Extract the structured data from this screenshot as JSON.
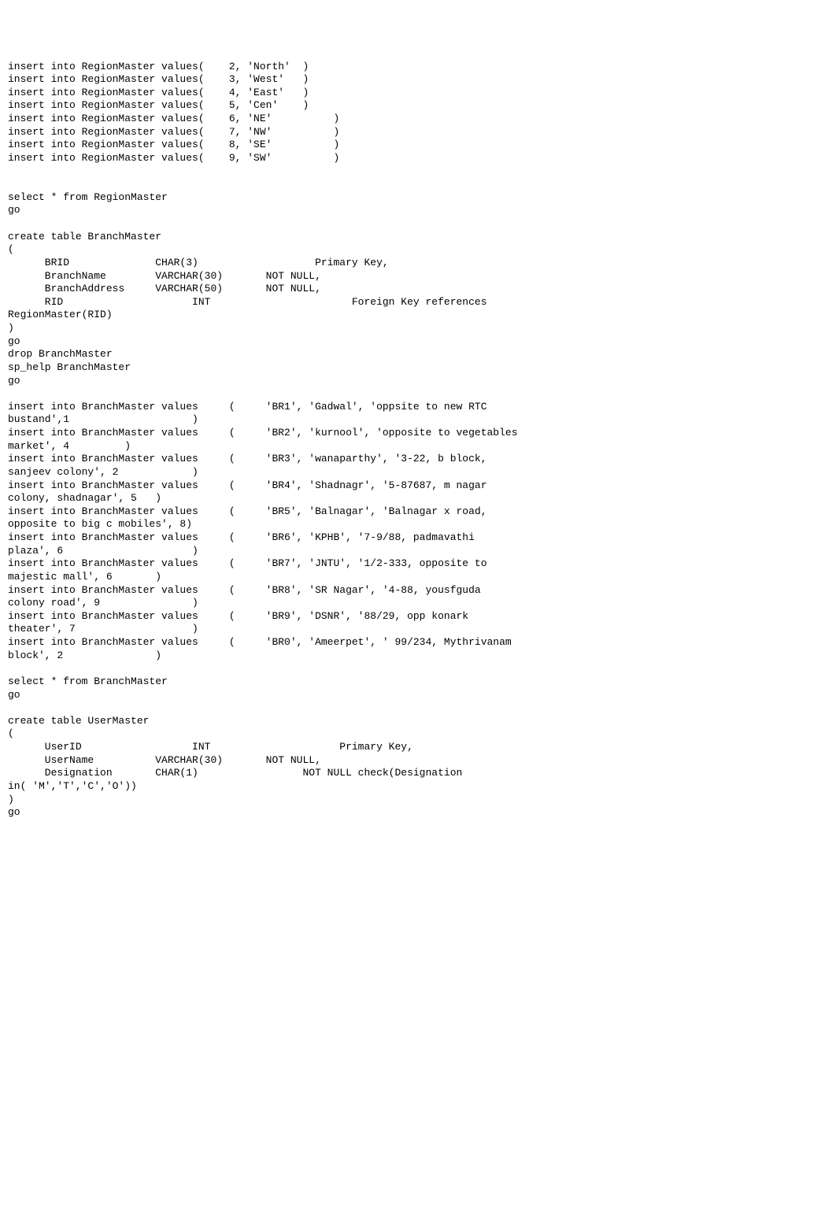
{
  "lines": [
    "insert into RegionMaster values(    2, 'North'  )",
    "insert into RegionMaster values(    3, 'West'   )",
    "insert into RegionMaster values(    4, 'East'   )",
    "insert into RegionMaster values(    5, 'Cen'    )",
    "insert into RegionMaster values(    6, 'NE'          )",
    "insert into RegionMaster values(    7, 'NW'          )",
    "insert into RegionMaster values(    8, 'SE'          )",
    "insert into RegionMaster values(    9, 'SW'          )",
    "",
    "",
    "select * from RegionMaster",
    "go",
    "",
    "create table BranchMaster",
    "(",
    "      BRID              CHAR(3)                   Primary Key,",
    "      BranchName        VARCHAR(30)       NOT NULL,",
    "      BranchAddress     VARCHAR(50)       NOT NULL,",
    "      RID                     INT                       Foreign Key references",
    "RegionMaster(RID)",
    ")",
    "go",
    "drop BranchMaster",
    "sp_help BranchMaster",
    "go",
    "",
    "insert into BranchMaster values     (     'BR1', 'Gadwal', 'oppsite to new RTC",
    "bustand',1                    )",
    "insert into BranchMaster values     (     'BR2', 'kurnool', 'opposite to vegetables",
    "market', 4         )",
    "insert into BranchMaster values     (     'BR3', 'wanaparthy', '3-22, b block,",
    "sanjeev colony', 2            )",
    "insert into BranchMaster values     (     'BR4', 'Shadnagr', '5-87687, m nagar",
    "colony, shadnagar', 5   )",
    "insert into BranchMaster values     (     'BR5', 'Balnagar', 'Balnagar x road,",
    "opposite to big c mobiles', 8)",
    "insert into BranchMaster values     (     'BR6', 'KPHB', '7-9/88, padmavathi",
    "plaza', 6                     )",
    "insert into BranchMaster values     (     'BR7', 'JNTU', '1/2-333, opposite to",
    "majestic mall', 6       )",
    "insert into BranchMaster values     (     'BR8', 'SR Nagar', '4-88, yousfguda",
    "colony road', 9               )",
    "insert into BranchMaster values     (     'BR9', 'DSNR', '88/29, opp konark",
    "theater', 7                   )",
    "insert into BranchMaster values     (     'BR0', 'Ameerpet', ' 99/234, Mythrivanam",
    "block', 2               )",
    "",
    "select * from BranchMaster",
    "go",
    "",
    "create table UserMaster",
    "(",
    "      UserID                  INT                     Primary Key,",
    "      UserName          VARCHAR(30)       NOT NULL,",
    "      Designation       CHAR(1)                 NOT NULL check(Designation",
    "in( 'M','T','C','O'))",
    ")",
    "go"
  ]
}
